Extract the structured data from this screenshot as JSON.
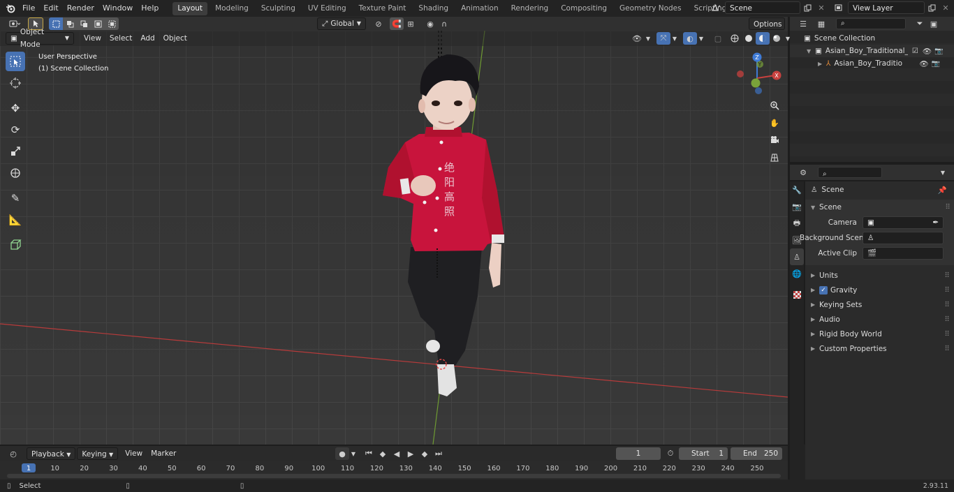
{
  "menu": [
    "File",
    "Edit",
    "Render",
    "Window",
    "Help"
  ],
  "workspaces": [
    "Layout",
    "Modeling",
    "Sculpting",
    "UV Editing",
    "Texture Paint",
    "Shading",
    "Animation",
    "Rendering",
    "Compositing",
    "Geometry Nodes",
    "Scripting"
  ],
  "active_workspace": "Layout",
  "scene_field": "Scene",
  "view_layer_field": "View Layer",
  "viewport": {
    "mode": "Object Mode",
    "menus": [
      "View",
      "Select",
      "Add",
      "Object"
    ],
    "transform_orientation": "Global",
    "options_label": "Options",
    "overlay_line1": "User Perspective",
    "overlay_line2": "(1) Scene Collection",
    "gizmo_axes": {
      "x": "X",
      "y": "Y",
      "z": "Z"
    }
  },
  "shirt_text": "绝 阳 高 照",
  "outliner": {
    "root": "Scene Collection",
    "items": [
      {
        "label": "Asian_Boy_Traditional_Costur"
      },
      {
        "label": "Asian_Boy_Traditional_C"
      }
    ]
  },
  "properties": {
    "header": "Scene",
    "section": "Scene",
    "fields": [
      {
        "label": "Camera"
      },
      {
        "label": "Background Scene"
      },
      {
        "label": "Active Clip"
      }
    ],
    "panels": [
      "Units",
      "Gravity",
      "Keying Sets",
      "Audio",
      "Rigid Body World",
      "Custom Properties"
    ]
  },
  "timeline": {
    "menus": [
      "Playback",
      "Keying",
      "View",
      "Marker"
    ],
    "current_frame": "1",
    "start_label": "Start",
    "start_value": "1",
    "end_label": "End",
    "end_value": "250",
    "ticks": [
      "1",
      "10",
      "20",
      "30",
      "40",
      "50",
      "60",
      "70",
      "80",
      "90",
      "100",
      "110",
      "120",
      "130",
      "140",
      "150",
      "160",
      "170",
      "180",
      "190",
      "200",
      "210",
      "220",
      "230",
      "240",
      "250"
    ]
  },
  "status": {
    "left": "Select",
    "version": "2.93.11"
  },
  "colors": {
    "accent": "#4772b3",
    "x_axis": "#c8413f",
    "y_axis": "#7aa33a",
    "z_axis": "#3f7bd6",
    "shirt": "#c8143c"
  }
}
